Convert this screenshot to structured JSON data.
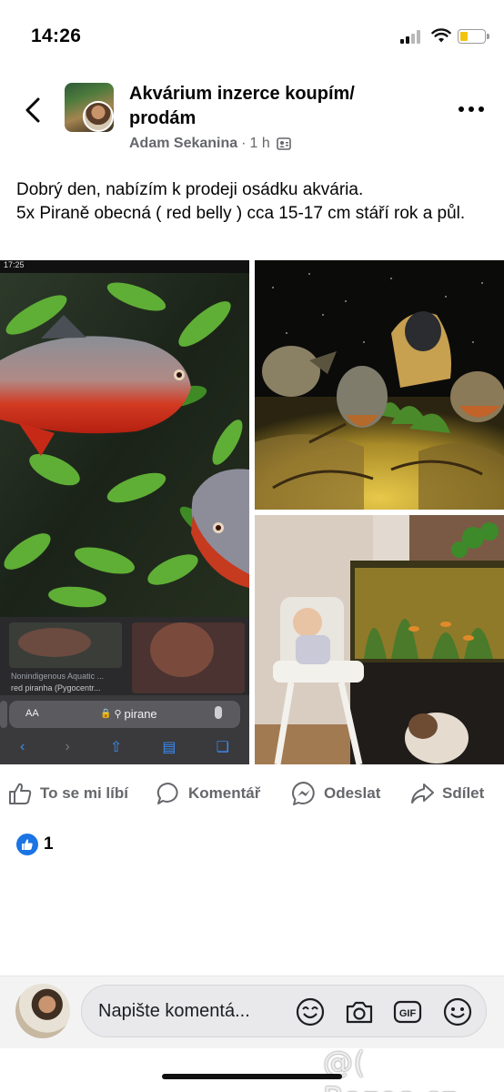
{
  "status_bar": {
    "time": "14:26"
  },
  "post": {
    "group_title": "Akvárium inzerce koupím/ prodám",
    "author": "Adam Sekanina",
    "separator": "·",
    "time_ago": "1 h",
    "text_lines": [
      "Dobrý den, nabízím k prodeji osádku akvária.",
      "5x Piraně obecná ( red belly ) cca 15-17 cm stáří rok a půl."
    ]
  },
  "screenshot_overlay": {
    "clock": "17:25",
    "search_caption": "Nonindigenous Aquatic ...",
    "search_caption_2": "red piranha (Pygocentr...",
    "address_aa": "AA",
    "address_query": "pirane"
  },
  "actions": {
    "like": "To se mi líbí",
    "comment": "Komentář",
    "send": "Odeslat",
    "share": "Sdílet"
  },
  "reactions": {
    "count": "1"
  },
  "composer": {
    "placeholder": "Napište komentá..."
  },
  "watermark": "@( Bazos.cz",
  "colors": {
    "accent": "#1b74e4",
    "secondary_text": "#65676b",
    "battery": "#f2c40f"
  },
  "icons": [
    "back-arrow-icon",
    "more-icon",
    "group-privacy-icon",
    "like-icon",
    "comment-icon",
    "messenger-icon",
    "share-icon",
    "avatar-sticker-icon",
    "camera-icon",
    "gif-icon",
    "emoji-icon"
  ]
}
